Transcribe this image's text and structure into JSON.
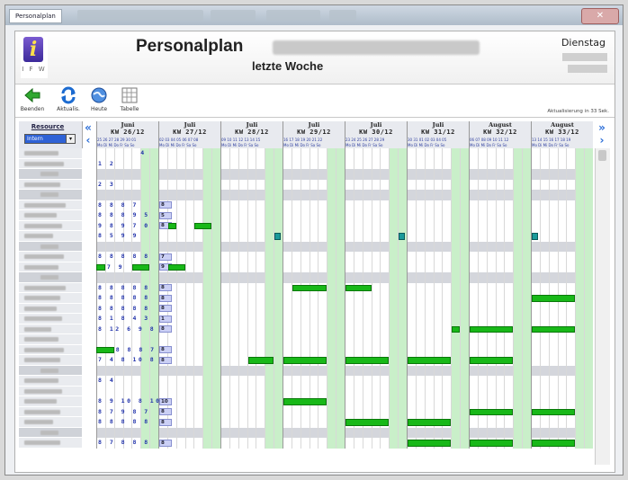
{
  "window": {
    "tab_label": "Personalplan",
    "close_icon": "close-icon"
  },
  "header": {
    "logo_letter": "i",
    "logo_caption": "I F W",
    "title": "Personalplan",
    "subtitle": "letzte Woche",
    "weekday": "Dienstag"
  },
  "toolbar": {
    "buttons": [
      {
        "label": "Beenden",
        "icon": "back-arrow-icon"
      },
      {
        "label": "Aktualis.",
        "icon": "refresh-icon"
      },
      {
        "label": "Heute",
        "icon": "globe-icon"
      },
      {
        "label": "Tabelle",
        "icon": "grid-icon"
      }
    ],
    "update_text": "Aktualisierung in 33 Sek."
  },
  "grid": {
    "resource_label": "Resource",
    "resource_select": "Intern",
    "weeks": [
      {
        "month": "Juni",
        "kw": "KW 26/12",
        "days": "25 26 27 28 29 30 01",
        "weekdays": "Mo Di Mi Do Fr Sa So"
      },
      {
        "month": "Juli",
        "kw": "KW 27/12",
        "days": "02 03 04 05 06 07 08",
        "weekdays": "Mo Di Mi Do Fr Sa So"
      },
      {
        "month": "Juli",
        "kw": "KW 28/12",
        "days": "09 10 11 12 13 14 15",
        "weekdays": "Mo Di Mi Do Fr Sa So"
      },
      {
        "month": "Juli",
        "kw": "KW 29/12",
        "days": "16 17 18 19 20 21 22",
        "weekdays": "Mo Di Mi Do Fr Sa So"
      },
      {
        "month": "Juli",
        "kw": "KW 30/12",
        "days": "23 24 25 26 27 28 29",
        "weekdays": "Mo Di Mi Do Fr Sa So"
      },
      {
        "month": "Juli",
        "kw": "KW 31/12",
        "days": "30 31 01 02 03 04 05",
        "weekdays": "Mo Di Mi Do Fr Sa So"
      },
      {
        "month": "August",
        "kw": "KW 32/12",
        "days": "06 07 08 09 10 11 12",
        "weekdays": "Mo Di Mi Do Fr Sa So"
      },
      {
        "month": "August",
        "kw": "KW 33/12",
        "days": "13 14 15 16 17 18 19",
        "weekdays": "Mo Di Mi Do Fr Sa So"
      }
    ],
    "rows": [
      {
        "kind": "person",
        "digits": "4",
        "digits_week": 0,
        "digits_day": 5
      },
      {
        "kind": "person",
        "digits": "1 2"
      },
      {
        "kind": "group"
      },
      {
        "kind": "person",
        "digits": "2 3"
      },
      {
        "kind": "group"
      },
      {
        "kind": "person",
        "digits": "8 8 8 7",
        "chip": "8"
      },
      {
        "kind": "person",
        "digits": "8 8 8 9 5",
        "chip": "5"
      },
      {
        "kind": "person",
        "digits": "9 8 9 7 0",
        "chip": "8",
        "bars": [
          {
            "week": 1,
            "start": 1,
            "len": 1
          },
          {
            "week": 1,
            "start": 4,
            "len": 2
          }
        ]
      },
      {
        "kind": "person",
        "digits": "8 5   9 9",
        "teal": [
          {
            "week": 2,
            "day": 6
          },
          {
            "week": 4,
            "day": 6
          },
          {
            "week": 7,
            "day": 0
          }
        ]
      },
      {
        "kind": "group"
      },
      {
        "kind": "person",
        "digits": "8 8 8 8 8",
        "chip": "7"
      },
      {
        "kind": "person",
        "digits": "7 9",
        "lead_bar": 1,
        "chip": "9",
        "bars": [
          {
            "week": 0,
            "start": 4,
            "len": 2
          },
          {
            "week": 1,
            "start": 1,
            "len": 2
          }
        ]
      },
      {
        "kind": "group"
      },
      {
        "kind": "person",
        "digits": "8 8 8 8 8",
        "chip": "8",
        "bars": [
          {
            "week": 3,
            "start": 1,
            "len": 4
          },
          {
            "week": 4,
            "start": 0,
            "len": 3
          }
        ]
      },
      {
        "kind": "person",
        "digits": "8 8 8 8 8",
        "chip": "8",
        "bars": [
          {
            "week": 7,
            "start": 0,
            "len": 5
          }
        ]
      },
      {
        "kind": "person",
        "digits": "8 8 8 8 8",
        "chip": "8"
      },
      {
        "kind": "person",
        "digits": "8 1 8 4 3",
        "chip": "1"
      },
      {
        "kind": "person",
        "digits": "8 12 6 9 8",
        "chip": "8",
        "bars": [
          {
            "week": 5,
            "start": 5,
            "len": 1
          },
          {
            "week": 6,
            "start": 0,
            "len": 5
          },
          {
            "week": 7,
            "start": 0,
            "len": 5
          }
        ]
      },
      {
        "kind": "person"
      },
      {
        "kind": "person",
        "digits": "8 8 8 7",
        "lead_bar": 2,
        "chip": "8"
      },
      {
        "kind": "person",
        "digits": "7 4 8 10 8",
        "chip": "8",
        "bars": [
          {
            "week": 2,
            "start": 3,
            "len": 3
          },
          {
            "week": 3,
            "start": 0,
            "len": 5
          },
          {
            "week": 4,
            "start": 0,
            "len": 5
          },
          {
            "week": 5,
            "start": 0,
            "len": 5
          },
          {
            "week": 6,
            "start": 0,
            "len": 5
          }
        ]
      },
      {
        "kind": "group"
      },
      {
        "kind": "person",
        "digits": "  8   4"
      },
      {
        "kind": "person"
      },
      {
        "kind": "person",
        "digits": "8 9 10 8 10",
        "chip": "10",
        "bars": [
          {
            "week": 3,
            "start": 0,
            "len": 5
          }
        ]
      },
      {
        "kind": "person",
        "digits": "8 7 9 8 7",
        "chip": "8",
        "bars": [
          {
            "week": 6,
            "start": 0,
            "len": 5
          },
          {
            "week": 7,
            "start": 0,
            "len": 5
          }
        ]
      },
      {
        "kind": "person",
        "digits": "8 8 8 8 8",
        "chip": "8",
        "bars": [
          {
            "week": 4,
            "start": 0,
            "len": 5
          },
          {
            "week": 5,
            "start": 0,
            "len": 5
          }
        ]
      },
      {
        "kind": "group"
      },
      {
        "kind": "person",
        "digits": "8 7 8 8 8",
        "chip": "8",
        "bars": [
          {
            "week": 5,
            "start": 0,
            "len": 5
          },
          {
            "week": 6,
            "start": 0,
            "len": 5
          },
          {
            "week": 7,
            "start": 0,
            "len": 5
          }
        ]
      }
    ]
  }
}
